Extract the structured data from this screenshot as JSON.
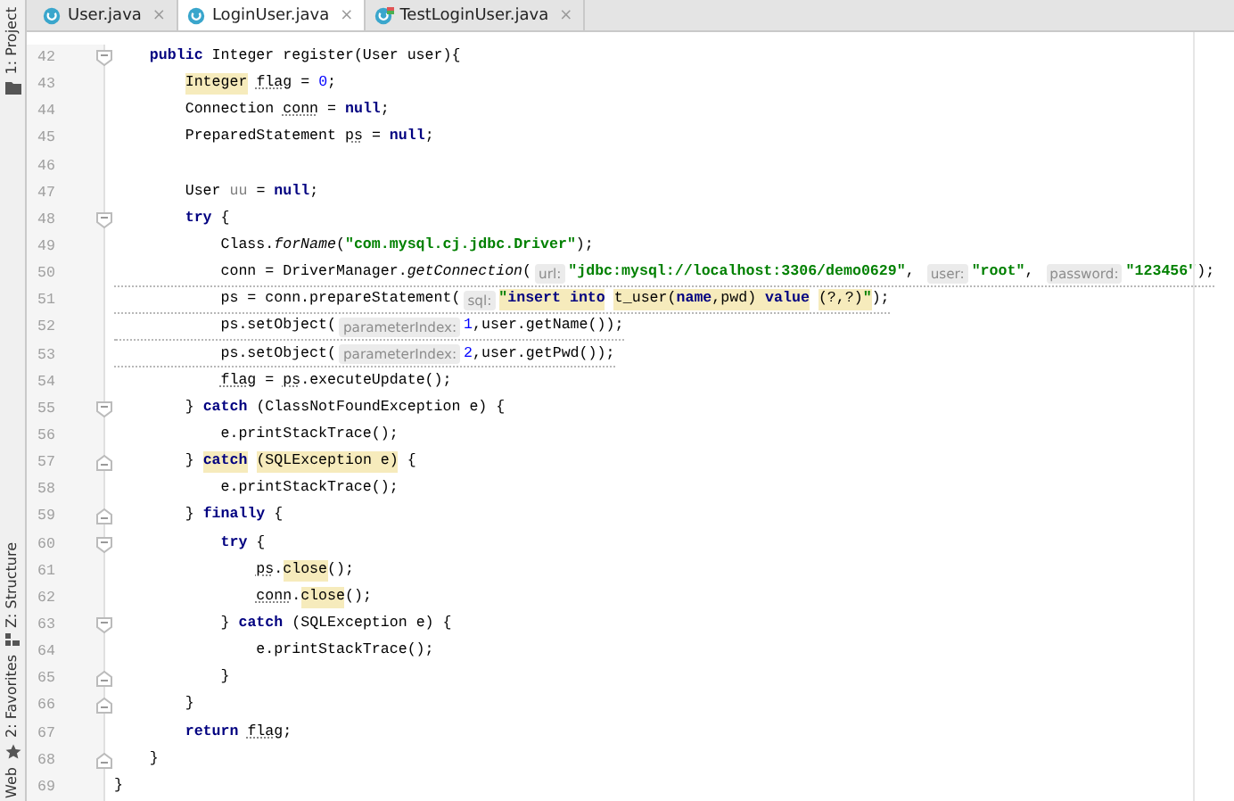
{
  "tabs": [
    {
      "label": "User.java",
      "kind": "class",
      "selected": false,
      "close": "×"
    },
    {
      "label": "LoginUser.java",
      "kind": "class",
      "selected": true,
      "close": "×"
    },
    {
      "label": "TestLoginUser.java",
      "kind": "test-class",
      "selected": false,
      "close": "×"
    }
  ],
  "tool_strip": [
    {
      "label": "1: Project",
      "kind": "project"
    },
    {
      "label": "Z: Structure",
      "kind": "structure"
    },
    {
      "label": "2: Favorites",
      "kind": "favorites"
    },
    {
      "label": "Web",
      "kind": "web"
    }
  ],
  "lines": [
    {
      "number": "42",
      "fold_start": true,
      "fold_end": false,
      "warning": false,
      "tokens": [
        {
          "kind": "keyword",
          "text": "    public"
        },
        {
          "kind": "code",
          "text": " Integer register(User user){"
        }
      ]
    },
    {
      "number": "43",
      "fold_start": false,
      "fold_end": false,
      "warning": false,
      "tokens": [
        {
          "kind": "code",
          "text": "        Integer",
          "marked": true
        },
        {
          "kind": "code",
          "text": " flag",
          "underlined": true
        },
        {
          "kind": "code",
          "text": " = "
        },
        {
          "kind": "number",
          "text": "0"
        },
        {
          "kind": "code",
          "text": ";"
        }
      ]
    },
    {
      "number": "44",
      "fold_start": false,
      "fold_end": false,
      "warning": false,
      "tokens": [
        {
          "kind": "code",
          "text": "        Connection"
        },
        {
          "kind": "code",
          "text": " conn",
          "underlined": true
        },
        {
          "kind": "code",
          "text": " = "
        },
        {
          "kind": "keyword",
          "text": "null"
        },
        {
          "kind": "code",
          "text": ";"
        }
      ]
    },
    {
      "number": "45",
      "fold_start": false,
      "fold_end": false,
      "warning": false,
      "tokens": [
        {
          "kind": "code",
          "text": "        PreparedStatement"
        },
        {
          "kind": "code",
          "text": " ps",
          "underlined": true
        },
        {
          "kind": "code",
          "text": " = "
        },
        {
          "kind": "keyword",
          "text": "null"
        },
        {
          "kind": "code",
          "text": ";"
        }
      ]
    },
    {
      "number": "46",
      "fold_start": false,
      "fold_end": false,
      "warning": false
    },
    {
      "number": "47",
      "fold_start": false,
      "fold_end": false,
      "warning": false,
      "tokens": [
        {
          "kind": "code",
          "text": "        User"
        },
        {
          "kind": "unused",
          "text": " uu"
        },
        {
          "kind": "code",
          "text": " = "
        },
        {
          "kind": "keyword",
          "text": "null"
        },
        {
          "kind": "code",
          "text": ";"
        }
      ]
    },
    {
      "number": "48",
      "fold_start": true,
      "fold_end": false,
      "warning": false,
      "tokens": [
        {
          "kind": "keyword",
          "text": "        try"
        },
        {
          "kind": "code",
          "text": " {"
        }
      ]
    },
    {
      "number": "49",
      "fold_start": false,
      "fold_end": false,
      "warning": false,
      "tokens": [
        {
          "kind": "code",
          "text": "            Class."
        },
        {
          "kind": "method",
          "text": "forName"
        },
        {
          "kind": "code",
          "text": "("
        },
        {
          "kind": "string",
          "text": "\"com.mysql.cj.jdbc.Driver\""
        },
        {
          "kind": "code",
          "text": ");"
        }
      ]
    },
    {
      "number": "50",
      "fold_start": false,
      "fold_end": false,
      "warning": true,
      "tokens": [
        {
          "kind": "code",
          "text": "            conn = DriverManager."
        },
        {
          "kind": "method",
          "text": "getConnection"
        },
        {
          "kind": "code",
          "text": "("
        },
        {
          "kind": "hint",
          "text": "url:"
        },
        {
          "kind": "string",
          "text": "\"jdbc:mysql://localhost:3306/demo0629\""
        },
        {
          "kind": "code",
          "text": ","
        },
        {
          "kind": "hint",
          "text": "user:"
        },
        {
          "kind": "string",
          "text": "\"root\""
        },
        {
          "kind": "code",
          "text": ","
        },
        {
          "kind": "hint",
          "text": "password:"
        },
        {
          "kind": "string",
          "text": "\"123456\""
        },
        {
          "kind": "code",
          "text": ");"
        }
      ]
    },
    {
      "number": "51",
      "fold_start": false,
      "fold_end": false,
      "warning": true,
      "tokens": [
        {
          "kind": "code",
          "text": "            ps = conn.prepareStatement("
        },
        {
          "kind": "hint",
          "text": "sql:"
        },
        {
          "kind": "string",
          "text": "\"",
          "marked": true
        },
        {
          "kind": "sql",
          "text": "insert into",
          "marked": true
        },
        {
          "kind": "code",
          "text": " t_user(",
          "marked": true
        },
        {
          "kind": "sql",
          "text": "name",
          "marked": true
        },
        {
          "kind": "code",
          "text": ",pwd) ",
          "marked": true
        },
        {
          "kind": "sql",
          "text": "value",
          "marked": true
        },
        {
          "kind": "code",
          "text": " (?,?)",
          "marked": true
        },
        {
          "kind": "string",
          "text": "\"",
          "marked": true
        },
        {
          "kind": "code",
          "text": ");"
        }
      ]
    },
    {
      "number": "52",
      "fold_start": false,
      "fold_end": false,
      "warning": true,
      "tokens": [
        {
          "kind": "code",
          "text": "            ps.setObject("
        },
        {
          "kind": "hint",
          "text": "parameterIndex:"
        },
        {
          "kind": "number",
          "text": "1"
        },
        {
          "kind": "code",
          "text": ",user.getName());"
        }
      ]
    },
    {
      "number": "53",
      "fold_start": false,
      "fold_end": false,
      "warning": true,
      "tokens": [
        {
          "kind": "code",
          "text": "            ps.setObject("
        },
        {
          "kind": "hint",
          "text": "parameterIndex:"
        },
        {
          "kind": "number",
          "text": "2"
        },
        {
          "kind": "code",
          "text": ",user.getPwd());"
        }
      ]
    },
    {
      "number": "54",
      "fold_start": false,
      "fold_end": false,
      "warning": false,
      "tokens": [
        {
          "kind": "code",
          "text": "            flag",
          "underlined": true
        },
        {
          "kind": "code",
          "text": " = "
        },
        {
          "kind": "code",
          "text": "ps",
          "underlined": true
        },
        {
          "kind": "code",
          "text": ".executeUpdate();"
        }
      ]
    },
    {
      "number": "55",
      "fold_start": true,
      "fold_end": false,
      "warning": false,
      "tokens": [
        {
          "kind": "code",
          "text": "        }"
        },
        {
          "kind": "keyword",
          "text": " catch"
        },
        {
          "kind": "code",
          "text": " (ClassNotFoundException e) {"
        }
      ]
    },
    {
      "number": "56",
      "fold_start": false,
      "fold_end": false,
      "warning": false,
      "tokens": [
        {
          "kind": "code",
          "text": "            e.printStackTrace();"
        }
      ]
    },
    {
      "number": "57",
      "fold_start": false,
      "fold_end": true,
      "warning": false,
      "tokens": [
        {
          "kind": "code",
          "text": "        }"
        },
        {
          "kind": "keyword",
          "text": " catch",
          "marked": true
        },
        {
          "kind": "code",
          "text": " (SQLException e)",
          "marked": true
        },
        {
          "kind": "code",
          "text": " {"
        }
      ]
    },
    {
      "number": "58",
      "fold_start": false,
      "fold_end": false,
      "warning": false,
      "tokens": [
        {
          "kind": "code",
          "text": "            e.printStackTrace();"
        }
      ]
    },
    {
      "number": "59",
      "fold_start": false,
      "fold_end": true,
      "warning": false,
      "tokens": [
        {
          "kind": "code",
          "text": "        }"
        },
        {
          "kind": "keyword",
          "text": " finally"
        },
        {
          "kind": "code",
          "text": " {"
        }
      ]
    },
    {
      "number": "60",
      "fold_start": true,
      "fold_end": false,
      "warning": false,
      "tokens": [
        {
          "kind": "keyword",
          "text": "            try"
        },
        {
          "kind": "code",
          "text": " {"
        }
      ]
    },
    {
      "number": "61",
      "fold_start": false,
      "fold_end": false,
      "warning": false,
      "tokens": [
        {
          "kind": "code",
          "text": "                ps",
          "underlined": true
        },
        {
          "kind": "code",
          "text": "."
        },
        {
          "kind": "code",
          "text": "close",
          "marked": true
        },
        {
          "kind": "code",
          "text": "();"
        }
      ]
    },
    {
      "number": "62",
      "fold_start": false,
      "fold_end": false,
      "warning": false,
      "tokens": [
        {
          "kind": "code",
          "text": "                conn",
          "underlined": true
        },
        {
          "kind": "code",
          "text": "."
        },
        {
          "kind": "code",
          "text": "close",
          "marked": true
        },
        {
          "kind": "code",
          "text": "();"
        }
      ]
    },
    {
      "number": "63",
      "fold_start": true,
      "fold_end": false,
      "warning": false,
      "tokens": [
        {
          "kind": "code",
          "text": "            }"
        },
        {
          "kind": "keyword",
          "text": " catch"
        },
        {
          "kind": "code",
          "text": " (SQLException e) {"
        }
      ]
    },
    {
      "number": "64",
      "fold_start": false,
      "fold_end": false,
      "warning": false,
      "tokens": [
        {
          "kind": "code",
          "text": "                e.printStackTrace();"
        }
      ]
    },
    {
      "number": "65",
      "fold_start": false,
      "fold_end": true,
      "warning": false,
      "tokens": [
        {
          "kind": "code",
          "text": "            }"
        }
      ]
    },
    {
      "number": "66",
      "fold_start": false,
      "fold_end": true,
      "warning": false,
      "tokens": [
        {
          "kind": "code",
          "text": "        }"
        }
      ]
    },
    {
      "number": "67",
      "fold_start": false,
      "fold_end": false,
      "warning": false,
      "tokens": [
        {
          "kind": "keyword",
          "text": "        return"
        },
        {
          "kind": "code",
          "text": " flag",
          "underlined": true
        },
        {
          "kind": "code",
          "text": ";"
        }
      ]
    },
    {
      "number": "68",
      "fold_start": false,
      "fold_end": true,
      "warning": false,
      "tokens": [
        {
          "kind": "code",
          "text": "    }"
        }
      ]
    },
    {
      "number": "69",
      "fold_start": false,
      "fold_end": false,
      "warning": false,
      "tokens": [
        {
          "kind": "code",
          "text": "}"
        }
      ]
    }
  ]
}
